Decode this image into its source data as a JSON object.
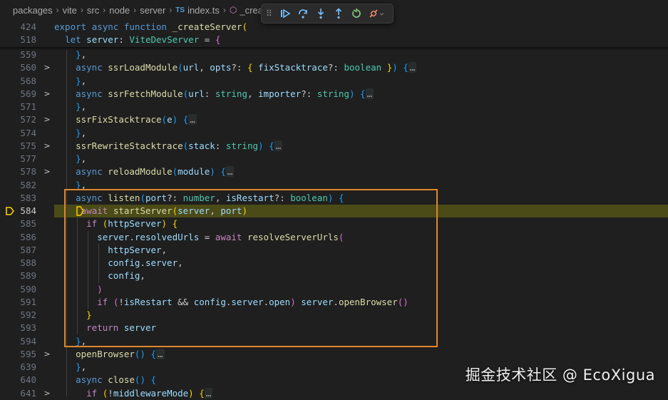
{
  "breadcrumb": {
    "items": [
      "packages",
      "vite",
      "src",
      "node",
      "server"
    ],
    "file_badge": "TS",
    "file": "index.ts",
    "symbol": "_crea"
  },
  "debug_toolbar": {
    "buttons": [
      "continue-icon",
      "step-over-icon",
      "step-into-icon",
      "step-out-icon",
      "restart-icon",
      "disconnect-icon"
    ]
  },
  "editor": {
    "sticky_lines": [
      {
        "num": "424",
        "tokens": [
          [
            "k",
            "export"
          ],
          [
            "p",
            " "
          ],
          [
            "k",
            "async"
          ],
          [
            "p",
            " "
          ],
          [
            "k",
            "function"
          ],
          [
            "p",
            " "
          ],
          [
            "f",
            "_createServer"
          ],
          [
            "b1",
            "("
          ]
        ]
      },
      {
        "num": "518",
        "tokens": [
          [
            "p",
            "  "
          ],
          [
            "k",
            "let"
          ],
          [
            "p",
            " "
          ],
          [
            "v",
            "server"
          ],
          [
            "p",
            ": "
          ],
          [
            "t",
            "ViteDevServer"
          ],
          [
            "p",
            " = "
          ],
          [
            "b2",
            "{"
          ]
        ]
      }
    ],
    "lines": [
      {
        "num": "559",
        "fold": "",
        "tokens": [
          [
            "p",
            "    "
          ],
          [
            "b3",
            "}"
          ],
          [
            "p",
            ","
          ]
        ]
      },
      {
        "num": "560",
        "fold": ">",
        "tokens": [
          [
            "p",
            "    "
          ],
          [
            "k",
            "async"
          ],
          [
            "p",
            " "
          ],
          [
            "f",
            "ssrLoadModule"
          ],
          [
            "b3",
            "("
          ],
          [
            "v",
            "url"
          ],
          [
            "p",
            ", "
          ],
          [
            "v",
            "opts"
          ],
          [
            "p",
            "?: "
          ],
          [
            "b1",
            "{"
          ],
          [
            "p",
            " "
          ],
          [
            "v",
            "fixStacktrace"
          ],
          [
            "p",
            "?: "
          ],
          [
            "t",
            "boolean"
          ],
          [
            "p",
            " "
          ],
          [
            "b1",
            "}"
          ],
          [
            "b3",
            ")"
          ],
          [
            "p",
            " "
          ],
          [
            "b3",
            "{"
          ],
          [
            "dots",
            "…"
          ]
        ]
      },
      {
        "num": "568",
        "fold": "",
        "tokens": [
          [
            "p",
            "    "
          ],
          [
            "b3",
            "}"
          ],
          [
            "p",
            ","
          ]
        ]
      },
      {
        "num": "569",
        "fold": ">",
        "tokens": [
          [
            "p",
            "    "
          ],
          [
            "k",
            "async"
          ],
          [
            "p",
            " "
          ],
          [
            "f",
            "ssrFetchModule"
          ],
          [
            "b3",
            "("
          ],
          [
            "v",
            "url"
          ],
          [
            "p",
            ": "
          ],
          [
            "t",
            "string"
          ],
          [
            "p",
            ", "
          ],
          [
            "v",
            "importer"
          ],
          [
            "p",
            "?: "
          ],
          [
            "t",
            "string"
          ],
          [
            "b3",
            ")"
          ],
          [
            "p",
            " "
          ],
          [
            "b3",
            "{"
          ],
          [
            "dots",
            "…"
          ]
        ]
      },
      {
        "num": "571",
        "fold": "",
        "tokens": [
          [
            "p",
            "    "
          ],
          [
            "b3",
            "}"
          ],
          [
            "p",
            ","
          ]
        ]
      },
      {
        "num": "572",
        "fold": ">",
        "tokens": [
          [
            "p",
            "    "
          ],
          [
            "f",
            "ssrFixStacktrace"
          ],
          [
            "b3",
            "("
          ],
          [
            "v",
            "e"
          ],
          [
            "b3",
            ")"
          ],
          [
            "p",
            " "
          ],
          [
            "b3",
            "{"
          ],
          [
            "dots",
            "…"
          ]
        ]
      },
      {
        "num": "574",
        "fold": "",
        "tokens": [
          [
            "p",
            "    "
          ],
          [
            "b3",
            "}"
          ],
          [
            "p",
            ","
          ]
        ]
      },
      {
        "num": "575",
        "fold": ">",
        "tokens": [
          [
            "p",
            "    "
          ],
          [
            "f",
            "ssrRewriteStacktrace"
          ],
          [
            "b3",
            "("
          ],
          [
            "v",
            "stack"
          ],
          [
            "p",
            ": "
          ],
          [
            "t",
            "string"
          ],
          [
            "b3",
            ")"
          ],
          [
            "p",
            " "
          ],
          [
            "b3",
            "{"
          ],
          [
            "dots",
            "…"
          ]
        ]
      },
      {
        "num": "577",
        "fold": "",
        "tokens": [
          [
            "p",
            "    "
          ],
          [
            "b3",
            "}"
          ],
          [
            "p",
            ","
          ]
        ]
      },
      {
        "num": "578",
        "fold": ">",
        "tokens": [
          [
            "p",
            "    "
          ],
          [
            "k",
            "async"
          ],
          [
            "p",
            " "
          ],
          [
            "f",
            "reloadModule"
          ],
          [
            "b3",
            "("
          ],
          [
            "v",
            "module"
          ],
          [
            "b3",
            ")"
          ],
          [
            "p",
            " "
          ],
          [
            "b3",
            "{"
          ],
          [
            "dots",
            "…"
          ]
        ]
      },
      {
        "num": "582",
        "fold": "",
        "tokens": [
          [
            "p",
            "    "
          ],
          [
            "b3",
            "}"
          ],
          [
            "p",
            ","
          ]
        ]
      },
      {
        "num": "583",
        "fold": "",
        "tokens": [
          [
            "p",
            "    "
          ],
          [
            "k",
            "async"
          ],
          [
            "p",
            " "
          ],
          [
            "f",
            "listen"
          ],
          [
            "b3",
            "("
          ],
          [
            "v",
            "port"
          ],
          [
            "p",
            "?: "
          ],
          [
            "t",
            "number"
          ],
          [
            "p",
            ", "
          ],
          [
            "v",
            "isRestart"
          ],
          [
            "p",
            "?: "
          ],
          [
            "t",
            "boolean"
          ],
          [
            "b3",
            ")"
          ],
          [
            "p",
            " "
          ],
          [
            "b3",
            "{"
          ]
        ]
      },
      {
        "num": "584",
        "fold": "",
        "tokens": [
          [
            "p",
            "     "
          ],
          [
            "c",
            "await"
          ],
          [
            "p",
            " "
          ],
          [
            "f",
            "startServer"
          ],
          [
            "b1",
            "("
          ],
          [
            "v",
            "server"
          ],
          [
            "p",
            ", "
          ],
          [
            "v",
            "port"
          ],
          [
            "b1",
            ")"
          ]
        ]
      },
      {
        "num": "585",
        "fold": "",
        "tokens": [
          [
            "p",
            "      "
          ],
          [
            "c",
            "if"
          ],
          [
            "p",
            " "
          ],
          [
            "b1",
            "("
          ],
          [
            "v",
            "httpServer"
          ],
          [
            "b1",
            ")"
          ],
          [
            "p",
            " "
          ],
          [
            "b1",
            "{"
          ]
        ]
      },
      {
        "num": "586",
        "fold": "",
        "tokens": [
          [
            "p",
            "        "
          ],
          [
            "v",
            "server"
          ],
          [
            "p",
            "."
          ],
          [
            "v",
            "resolvedUrls"
          ],
          [
            "p",
            " = "
          ],
          [
            "c",
            "await"
          ],
          [
            "p",
            " "
          ],
          [
            "f",
            "resolveServerUrls"
          ],
          [
            "b2",
            "("
          ]
        ]
      },
      {
        "num": "587",
        "fold": "",
        "tokens": [
          [
            "p",
            "          "
          ],
          [
            "v",
            "httpServer"
          ],
          [
            "p",
            ","
          ]
        ]
      },
      {
        "num": "588",
        "fold": "",
        "tokens": [
          [
            "p",
            "          "
          ],
          [
            "v",
            "config"
          ],
          [
            "p",
            "."
          ],
          [
            "v",
            "server"
          ],
          [
            "p",
            ","
          ]
        ]
      },
      {
        "num": "589",
        "fold": "",
        "tokens": [
          [
            "p",
            "          "
          ],
          [
            "v",
            "config"
          ],
          [
            "p",
            ","
          ]
        ]
      },
      {
        "num": "590",
        "fold": "",
        "tokens": [
          [
            "p",
            "        "
          ],
          [
            "b2",
            ")"
          ]
        ]
      },
      {
        "num": "591",
        "fold": "",
        "tokens": [
          [
            "p",
            "        "
          ],
          [
            "c",
            "if"
          ],
          [
            "p",
            " "
          ],
          [
            "b2",
            "("
          ],
          [
            "p",
            "!"
          ],
          [
            "v",
            "isRestart"
          ],
          [
            "p",
            " && "
          ],
          [
            "v",
            "config"
          ],
          [
            "p",
            "."
          ],
          [
            "v",
            "server"
          ],
          [
            "p",
            "."
          ],
          [
            "v",
            "open"
          ],
          [
            "b2",
            ")"
          ],
          [
            "p",
            " "
          ],
          [
            "v",
            "server"
          ],
          [
            "p",
            "."
          ],
          [
            "f",
            "openBrowser"
          ],
          [
            "b2",
            "()"
          ]
        ]
      },
      {
        "num": "592",
        "fold": "",
        "tokens": [
          [
            "p",
            "      "
          ],
          [
            "b1",
            "}"
          ]
        ]
      },
      {
        "num": "593",
        "fold": "",
        "tokens": [
          [
            "p",
            "      "
          ],
          [
            "c",
            "return"
          ],
          [
            "p",
            " "
          ],
          [
            "v",
            "server"
          ]
        ]
      },
      {
        "num": "594",
        "fold": "",
        "tokens": [
          [
            "p",
            "    "
          ],
          [
            "b3",
            "}"
          ],
          [
            "p",
            ","
          ]
        ]
      },
      {
        "num": "595",
        "fold": ">",
        "tokens": [
          [
            "p",
            "    "
          ],
          [
            "f",
            "openBrowser"
          ],
          [
            "b3",
            "()"
          ],
          [
            "p",
            " "
          ],
          [
            "b3",
            "{"
          ],
          [
            "dots",
            "…"
          ]
        ]
      },
      {
        "num": "639",
        "fold": "",
        "tokens": [
          [
            "p",
            "    "
          ],
          [
            "b3",
            "}"
          ],
          [
            "p",
            ","
          ]
        ]
      },
      {
        "num": "640",
        "fold": "",
        "tokens": [
          [
            "p",
            "    "
          ],
          [
            "k",
            "async"
          ],
          [
            "p",
            " "
          ],
          [
            "f",
            "close"
          ],
          [
            "b3",
            "()"
          ],
          [
            "p",
            " "
          ],
          [
            "b3",
            "{"
          ]
        ]
      },
      {
        "num": "641",
        "fold": ">",
        "tokens": [
          [
            "p",
            "      "
          ],
          [
            "c",
            "if"
          ],
          [
            "p",
            " "
          ],
          [
            "b1",
            "("
          ],
          [
            "p",
            "!"
          ],
          [
            "v",
            "middlewareMode"
          ],
          [
            "b1",
            ")"
          ],
          [
            "p",
            " "
          ],
          [
            "b1",
            "{"
          ],
          [
            "dots",
            "…"
          ]
        ]
      }
    ],
    "active_line": "584"
  },
  "watermark": "掘金技术社区 @ EcoXigua",
  "colors": {
    "background": "#1f1f1f",
    "current_line": "#4b4b18",
    "selection_box": "#e0872a",
    "keyword": "#569cd6",
    "control": "#c586c0",
    "function": "#dcdcaa",
    "variable": "#9cdcfe",
    "type": "#4ec9b0"
  }
}
